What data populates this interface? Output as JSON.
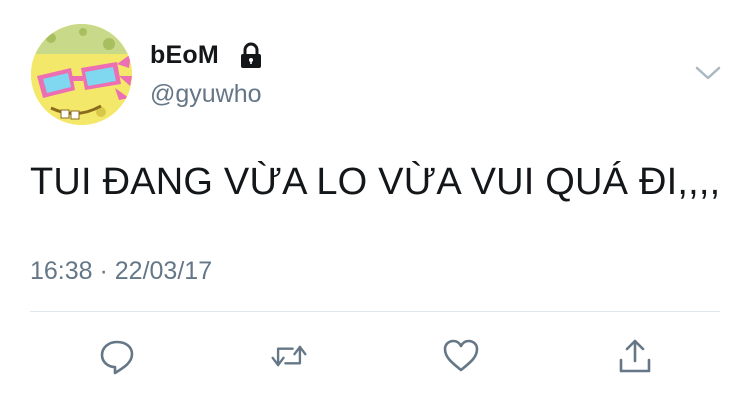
{
  "user": {
    "display_name": "bEoM",
    "handle": "@gyuwho",
    "protected": true
  },
  "tweet": {
    "text": "TUI ĐANG VỪA LO VỪA VUI QUÁ ĐI,,,,",
    "timestamp": "16:38 · 22/03/17"
  },
  "actions": [
    {
      "icon": "reply-icon"
    },
    {
      "icon": "retweet-icon"
    },
    {
      "icon": "like-icon"
    },
    {
      "icon": "share-icon"
    }
  ],
  "colors": {
    "text": "#14171a",
    "secondary": "#657786",
    "divider": "#e1e8ed",
    "caret": "#aab8c2"
  }
}
